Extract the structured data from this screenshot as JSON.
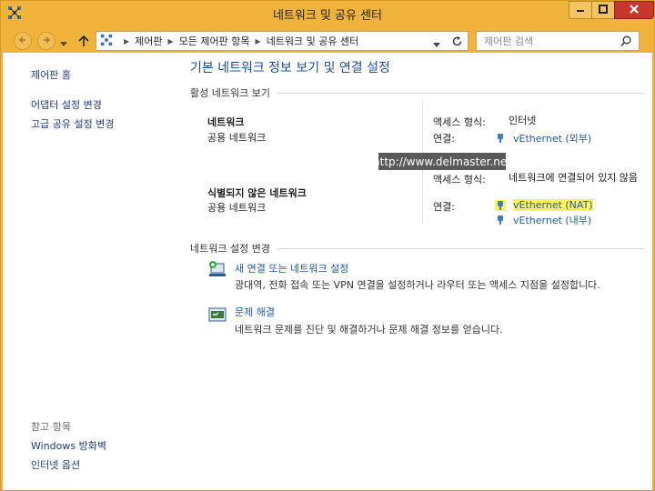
{
  "window": {
    "title": "네트워크 및 공유 센터"
  },
  "address": {
    "crumbs": [
      "제어판",
      "모든 제어판 항목",
      "네트워크 및 공유 센터"
    ],
    "search_placeholder": "제어판 검색"
  },
  "sidebar": {
    "home": "제어판 홈",
    "links": [
      "어댑터 설정 변경",
      "고급 공유 설정 변경"
    ],
    "see_also_heading": "참고 항목",
    "see_also": [
      "Windows 방화벽",
      "인터넷 옵션"
    ]
  },
  "main": {
    "title": "기본 네트워크 정보 보기 및 연결 설정",
    "active_heading": "활성 네트워크 보기",
    "networks": [
      {
        "name": "네트워크",
        "type": "공용 네트워크",
        "access_label": "액세스 형식:",
        "access_value": "인터넷",
        "conn_label": "연결:",
        "connections": [
          "vEthernet (외부)"
        ]
      },
      {
        "name": "식별되지 않은 네트워크",
        "type": "공용 네트워크",
        "access_label": "액세스 형식:",
        "access_value": "네트워크에 연결되어 있지 않음",
        "conn_label": "연결:",
        "connections": [
          "vEthernet (NAT)",
          "vEthernet (내부)"
        ]
      }
    ],
    "settings_heading": "네트워크 설정 변경",
    "tasks": [
      {
        "link": "새 연결 또는 네트워크 설정",
        "desc": "광대역, 전화 접속 또는 VPN 연결을 설정하거나 라우터 또는 액세스 지점을 설정합니다."
      },
      {
        "link": "문제 해결",
        "desc": "네트워크 문제를 진단 및 해결하거나 문제 해결 정보를 얻습니다."
      }
    ]
  },
  "overlay": {
    "watermark": "http://www.delmaster.net"
  },
  "colors": {
    "frame": "#f0b43c",
    "link": "#1e5aa8",
    "title": "#1e4f95",
    "highlight": "#fff35a",
    "close": "#c7382a"
  }
}
